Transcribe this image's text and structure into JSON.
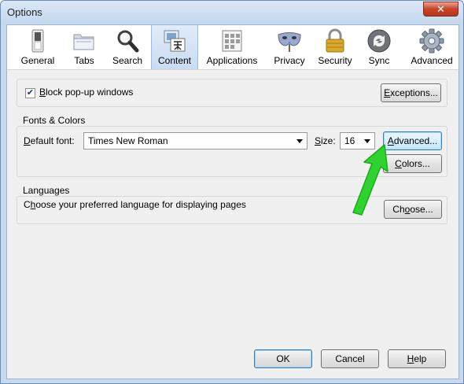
{
  "window": {
    "title": "Options",
    "close_glyph": "✕"
  },
  "tabs": [
    {
      "label": "General",
      "icon": "switch-icon",
      "selected": false
    },
    {
      "label": "Tabs",
      "icon": "folders-icon",
      "selected": false
    },
    {
      "label": "Search",
      "icon": "magnifier-icon",
      "selected": false
    },
    {
      "label": "Content",
      "icon": "content-page-icon",
      "selected": true
    },
    {
      "label": "Applications",
      "icon": "applications-icon",
      "selected": false
    },
    {
      "label": "Privacy",
      "icon": "mask-icon",
      "selected": false
    },
    {
      "label": "Security",
      "icon": "padlock-icon",
      "selected": false
    },
    {
      "label": "Sync",
      "icon": "sync-icon",
      "selected": false
    },
    {
      "label": "Advanced",
      "icon": "gear-icon",
      "selected": false
    }
  ],
  "popups": {
    "checkbox_label_accel": "B",
    "checkbox_label_rest": "lock pop-up windows",
    "checked": true,
    "check_glyph": "✔",
    "exceptions_accel": "E",
    "exceptions_rest": "xceptions..."
  },
  "fonts": {
    "group_title": "Fonts & Colors",
    "default_font_accel": "D",
    "default_font_rest": "efault font:",
    "font_value": "Times New Roman",
    "size_accel": "S",
    "size_rest": "ize:",
    "size_value": "16",
    "advanced_accel": "A",
    "advanced_rest": "dvanced...",
    "colors_accel": "C",
    "colors_rest": "olors..."
  },
  "languages": {
    "group_title": "Languages",
    "description_pre": "C",
    "description_accel": "h",
    "description_rest": "oose your preferred language for displaying pages",
    "choose_pre": "Ch",
    "choose_accel": "o",
    "choose_rest": "ose..."
  },
  "footer": {
    "ok": "OK",
    "cancel": "Cancel",
    "help_accel": "H",
    "help_rest": "elp"
  },
  "colors": {
    "selected_tab": "#c9dcf2",
    "close_button": "#c7432a",
    "annotation_arrow": "#2fd32f"
  }
}
